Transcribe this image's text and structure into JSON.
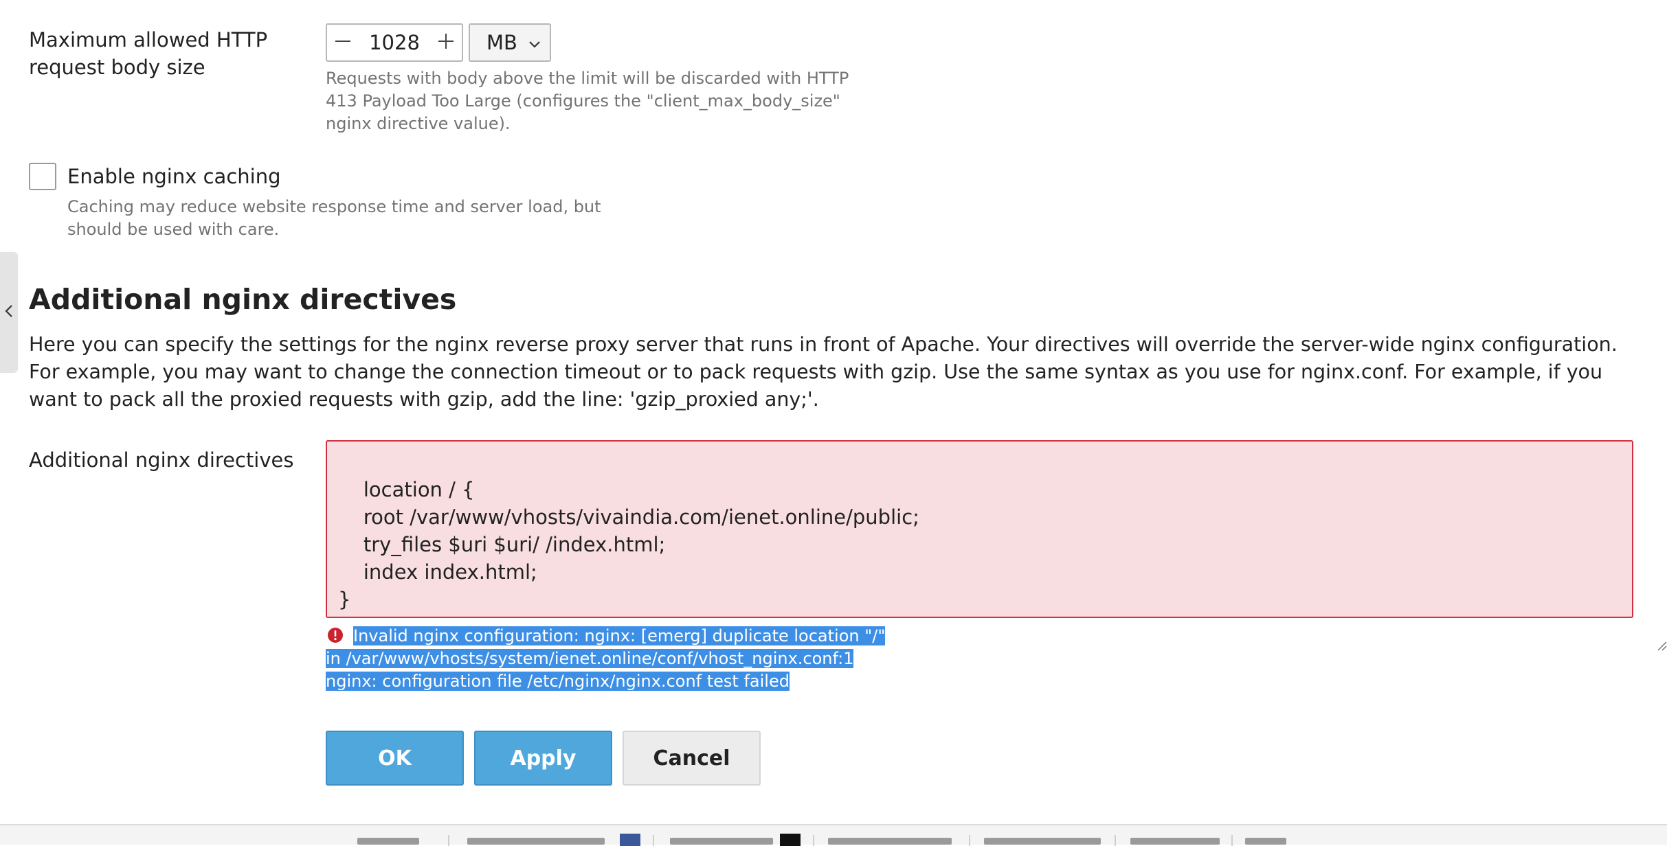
{
  "body_size": {
    "label": "Maximum allowed HTTP request body size",
    "value": "1028",
    "unit": "MB",
    "hint": "Requests with body above the limit will be discarded with HTTP 413 Payload Too Large (configures the \"client_max_body_size\" nginx directive value)."
  },
  "caching": {
    "label": "Enable nginx caching",
    "checked": false,
    "hint": "Caching may reduce website response time and server load, but should be used with care."
  },
  "section": {
    "title": "Additional nginx directives",
    "description": "Here you can specify the settings for the nginx reverse proxy server that runs in front of Apache. Your directives will override the server-wide nginx configuration. For example, you may want to change the connection timeout or to pack requests with gzip. Use the same syntax as you use for nginx.conf. For example, if you want to pack all the proxied requests with gzip, add the line: 'gzip_proxied any;'."
  },
  "directives": {
    "label": "Additional nginx directives",
    "value": "location / {\n    root /var/www/vhosts/vivaindia.com/ienet.online/public;\n    try_files $uri $uri/ /index.html;\n    index index.html;\n}",
    "error": "Invalid nginx configuration: nginx: [emerg] duplicate location \"/\" in /var/www/vhosts/system/ienet.online/conf/vhost_nginx.conf:1 nginx: configuration file /etc/nginx/nginx.conf test failed"
  },
  "buttons": {
    "ok": "OK",
    "apply": "Apply",
    "cancel": "Cancel"
  },
  "colors": {
    "primary": "#4fa7dc",
    "error_border": "#d0313f",
    "error_bg": "#f9dee1",
    "selection": "#3d8fe6"
  },
  "icons": [
    "chevron-left-icon",
    "minus-icon",
    "plus-icon",
    "chevron-down-icon",
    "error-icon",
    "resize-grip-icon"
  ]
}
